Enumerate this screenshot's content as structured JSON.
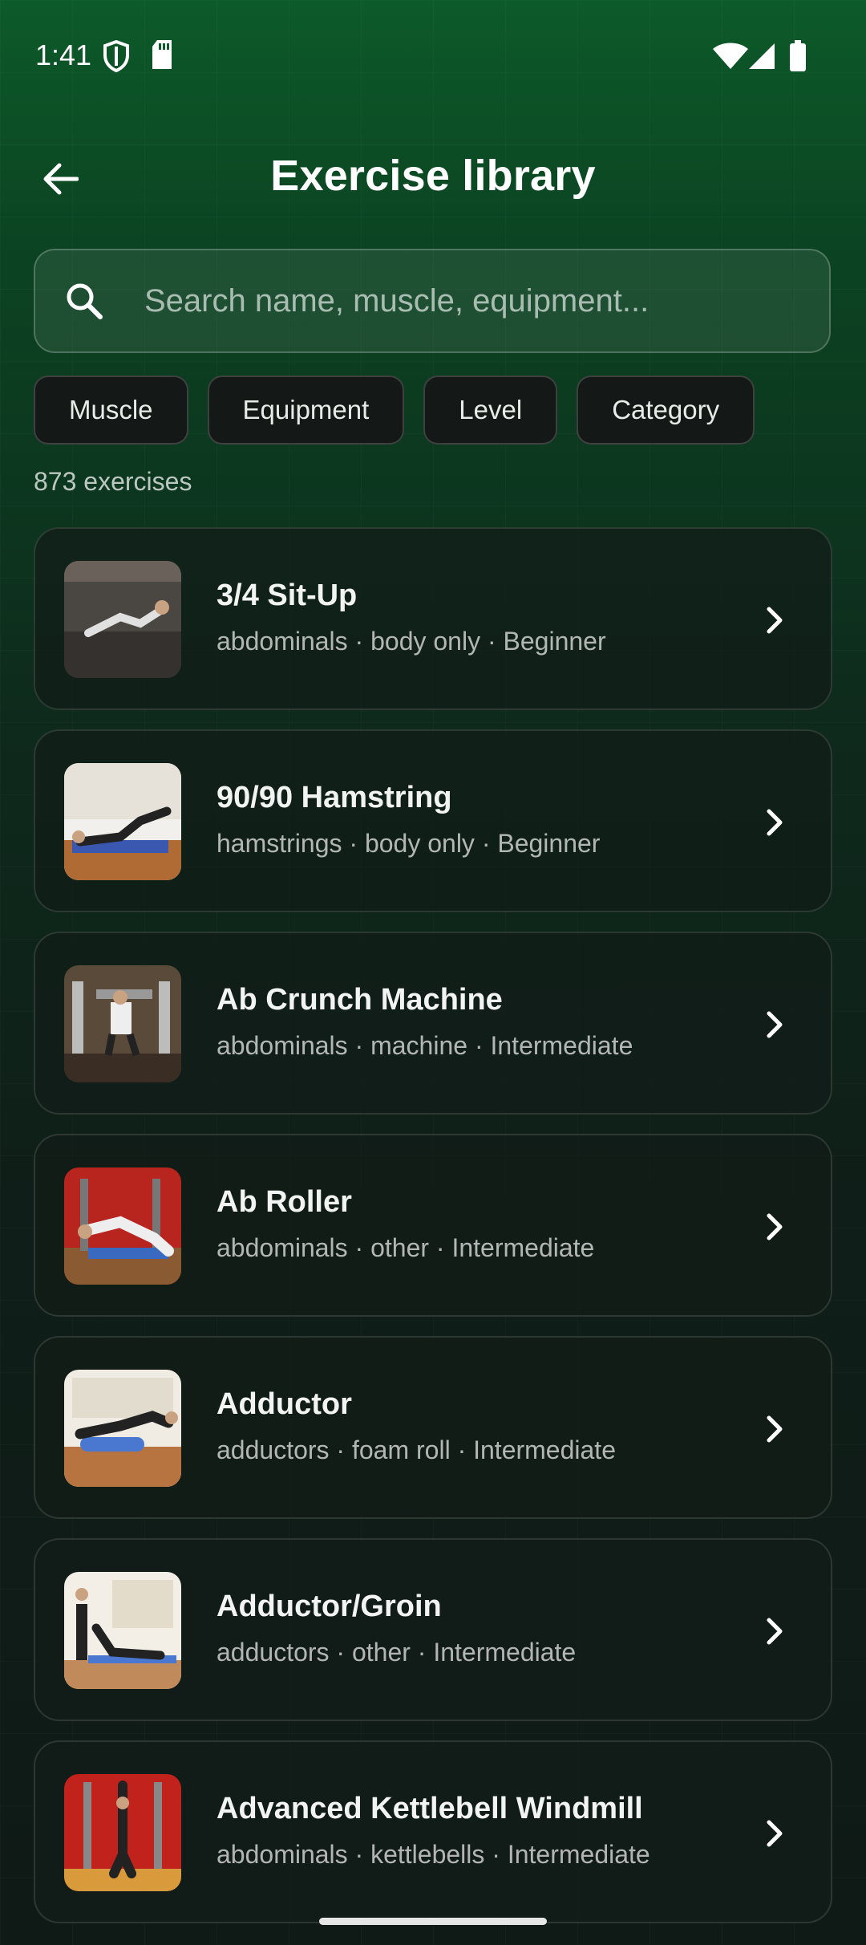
{
  "status_bar": {
    "time": "1:41"
  },
  "header": {
    "title": "Exercise library"
  },
  "search": {
    "placeholder": "Search name, muscle, equipment..."
  },
  "filters": [
    "Muscle",
    "Equipment",
    "Level",
    "Category"
  ],
  "results_count": "873 exercises",
  "exercises": [
    {
      "name": "3/4 Sit-Up",
      "meta": "abdominals · body only · Beginner"
    },
    {
      "name": "90/90 Hamstring",
      "meta": "hamstrings · body only · Beginner"
    },
    {
      "name": "Ab Crunch Machine",
      "meta": "abdominals · machine · Intermediate"
    },
    {
      "name": "Ab Roller",
      "meta": "abdominals · other · Intermediate"
    },
    {
      "name": "Adductor",
      "meta": "adductors · foam roll · Intermediate"
    },
    {
      "name": "Adductor/Groin",
      "meta": "adductors · other · Intermediate"
    },
    {
      "name": "Advanced Kettlebell Windmill",
      "meta": "abdominals · kettlebells · Intermediate"
    }
  ],
  "colors": {
    "accent": "#0d5a2a",
    "card": "#121c18"
  }
}
